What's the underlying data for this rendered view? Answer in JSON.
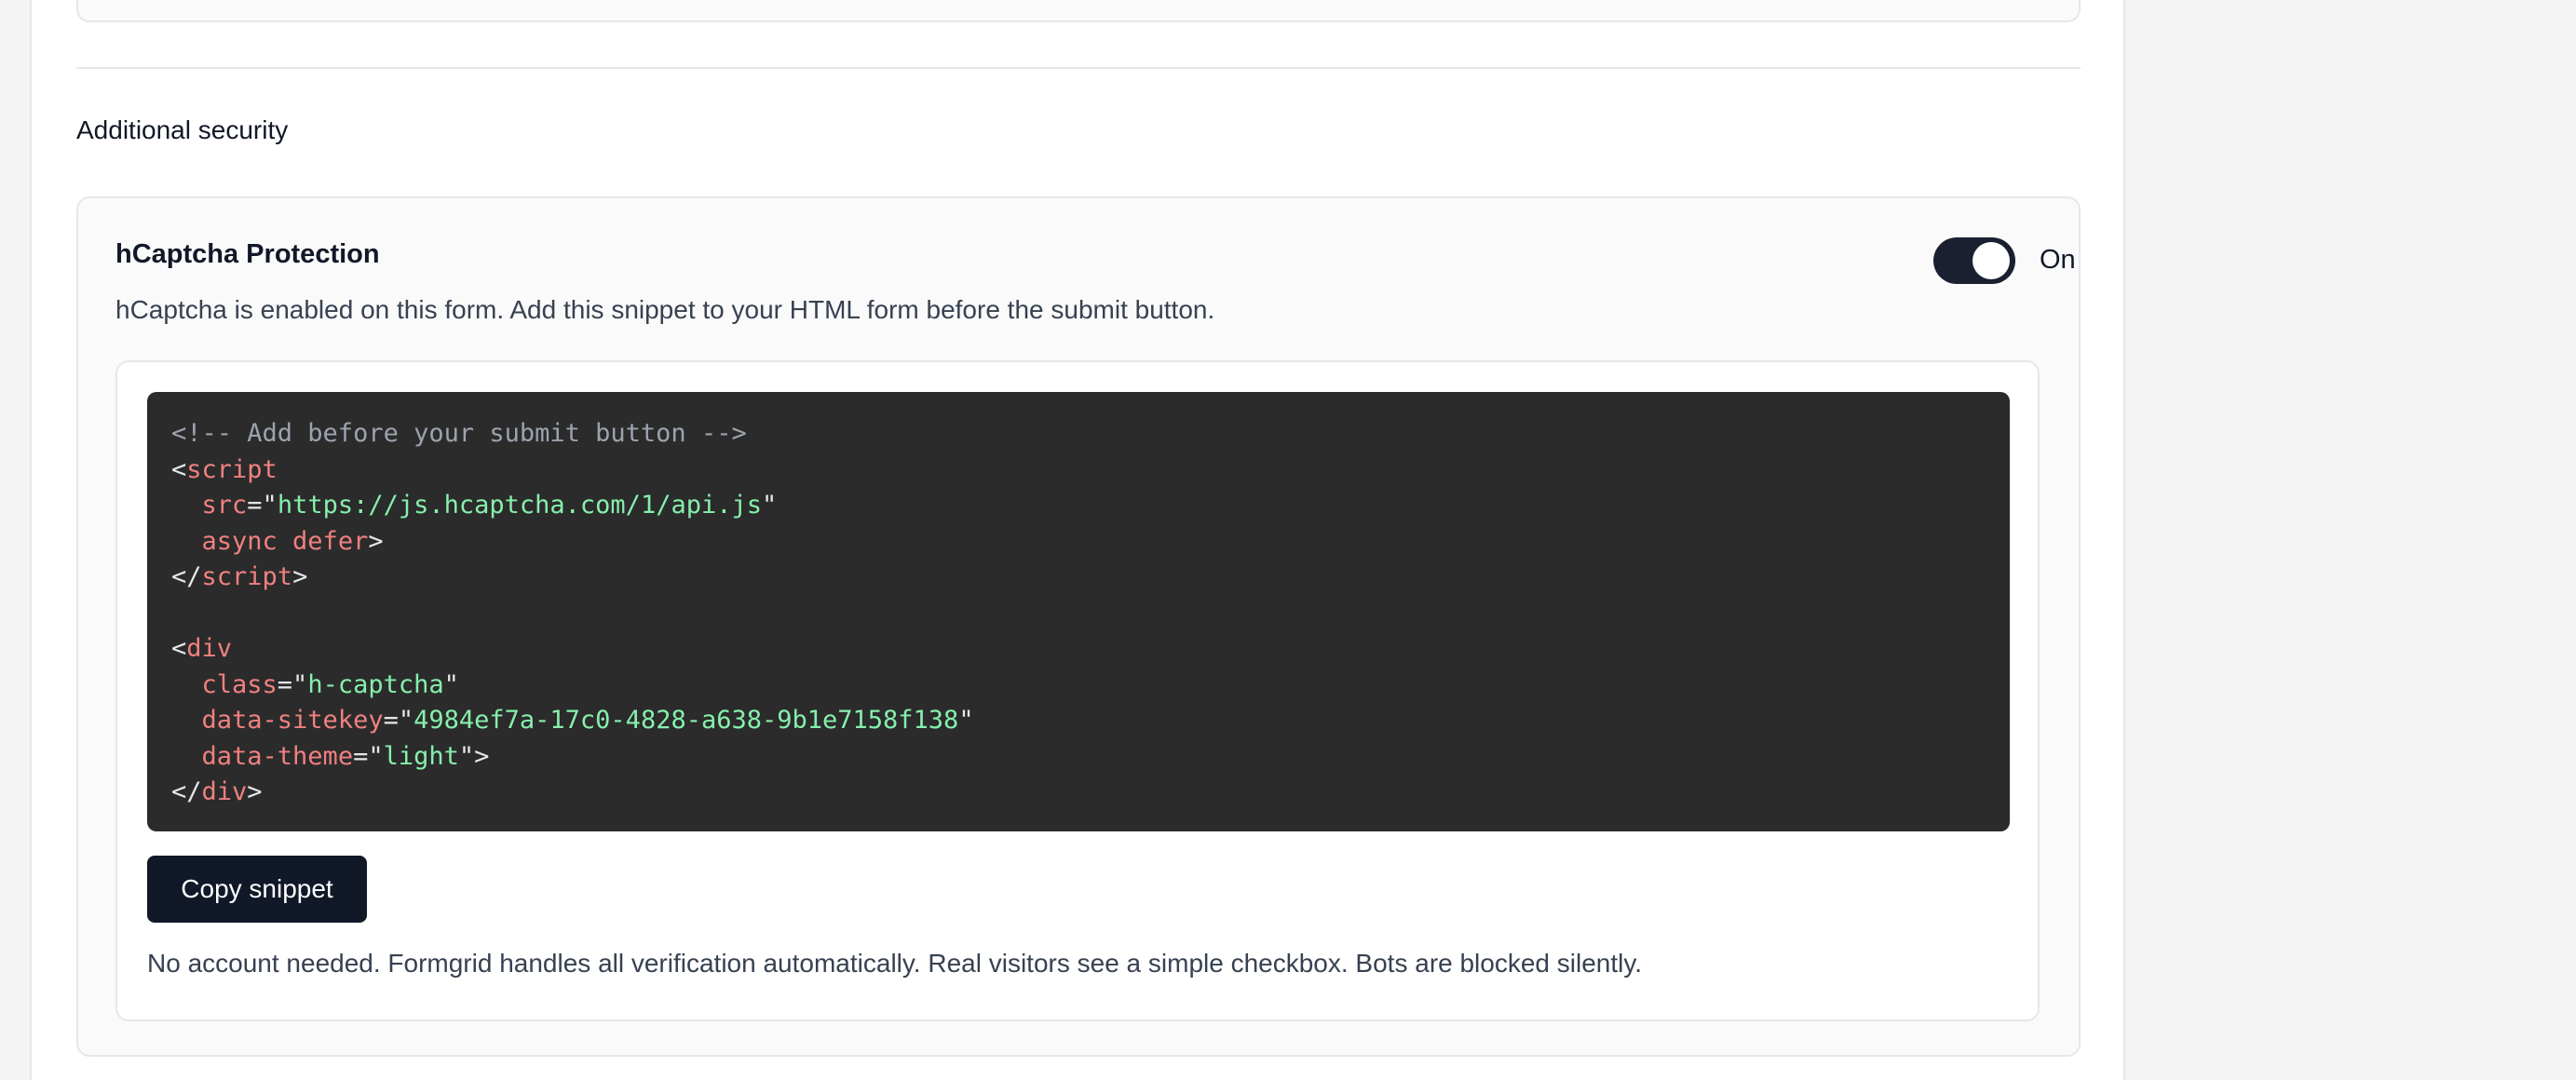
{
  "section": {
    "title": "Additional security"
  },
  "hcaptcha": {
    "title": "hCaptcha Protection",
    "description": "hCaptcha is enabled on this form. Add this snippet to your HTML form before the submit button.",
    "toggle_state": "On",
    "toggle_enabled": true,
    "snippet": {
      "comment": "<!-- Add before your submit button -->",
      "script_tag": "script",
      "src_attr": "src",
      "src_value": "https://js.hcaptcha.com/1/api.js",
      "async_defer": "async defer",
      "div_tag": "div",
      "class_attr": "class",
      "class_value": "h-captcha",
      "sitekey_attr": "data-sitekey",
      "sitekey_value": "4984ef7a-17c0-4828-a638-9b1e7158f138",
      "theme_attr": "data-theme",
      "theme_value": "light"
    },
    "copy_button_label": "Copy snippet",
    "footnote": "No account needed. Formgrid handles all verification automatically. Real visitors see a simple checkbox. Bots are blocked silently."
  },
  "colors": {
    "code_background": "#2b2b2b",
    "code_tag": "#f08080",
    "code_string": "#86efac",
    "code_comment": "#9ca3af",
    "primary_dark": "#111827"
  }
}
